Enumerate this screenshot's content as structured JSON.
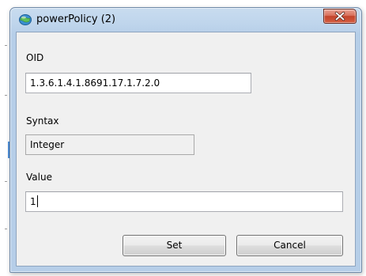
{
  "window": {
    "title": "powerPolicy (2)",
    "app_icon": "globe-icon",
    "close_icon": "close-icon",
    "close_button_color": "#c94a32"
  },
  "form": {
    "oid": {
      "label": "OID",
      "value": "1.3.6.1.4.1.8691.17.1.7.2.0"
    },
    "syntax": {
      "label": "Syntax",
      "value": "Integer"
    },
    "value": {
      "label": "Value",
      "value": "1"
    }
  },
  "buttons": {
    "set_label": "Set",
    "cancel_label": "Cancel"
  }
}
